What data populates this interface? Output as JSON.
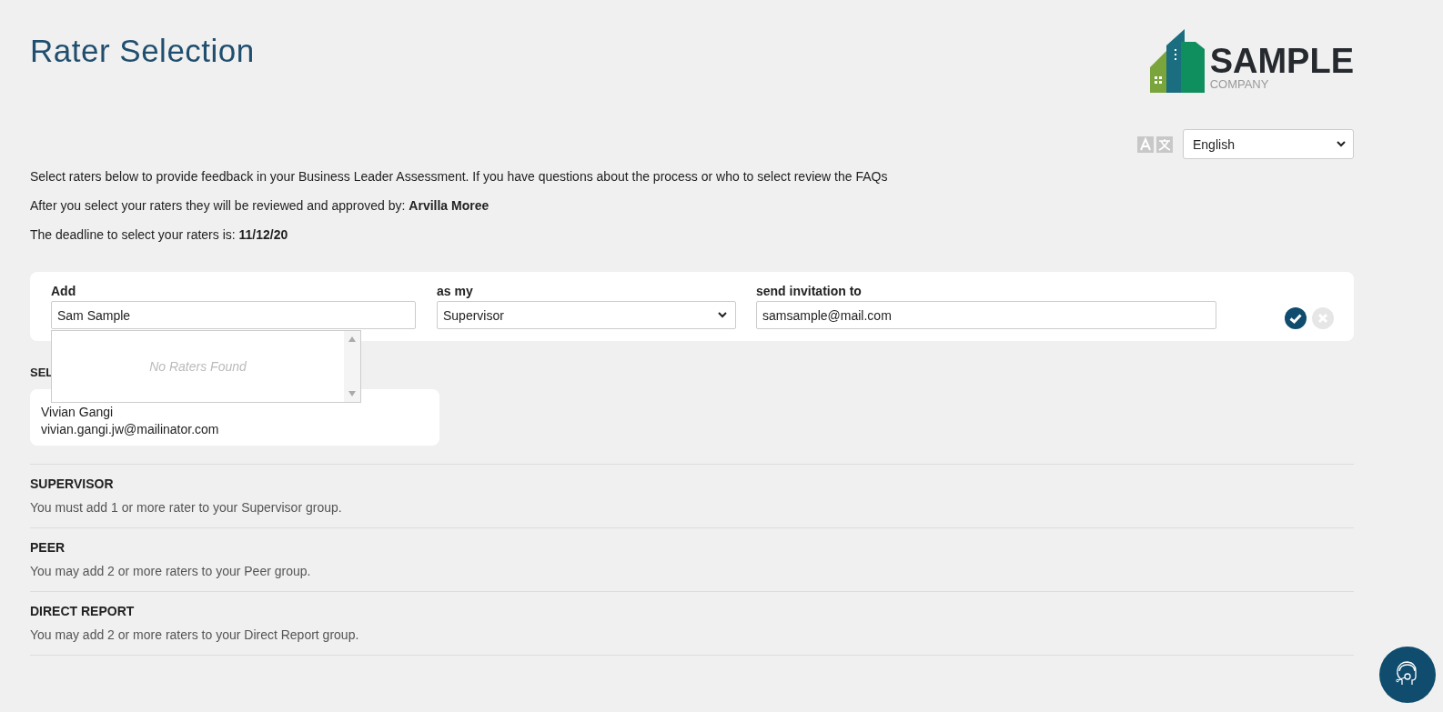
{
  "title": "Rater Selection",
  "logo": {
    "name": "SAMPLE",
    "subtitle": "COMPANY"
  },
  "language": {
    "value": "English"
  },
  "intro": [
    "Select raters below to provide feedback in your Business Leader Assessment. If you have questions about the process or who to select review the FAQs",
    "After you select your raters they will be reviewed and approved by: **Arvilla Moree**",
    "The deadline to select your raters is: **11/12/20**"
  ],
  "add_form": {
    "add_label": "Add",
    "add_value": "Sam Sample",
    "as_label": "as my",
    "as_value": "Supervisor",
    "send_label": "send invitation to",
    "send_value": "samsample@mail.com",
    "suggestions_empty": "No Raters Found"
  },
  "selected": {
    "heading": "SEL",
    "raters": [
      {
        "name": "Vivian Gangi",
        "email": "vivian.gangi.jw@mailinator.com"
      }
    ]
  },
  "groups": [
    {
      "name": "SUPERVISOR",
      "note": "You must add 1 or more rater to your Supervisor group."
    },
    {
      "name": "PEER",
      "note": "You may add 2 or more raters to your Peer group."
    },
    {
      "name": "DIRECT REPORT",
      "note": "You may add 2 or more raters to your Direct Report group."
    }
  ]
}
